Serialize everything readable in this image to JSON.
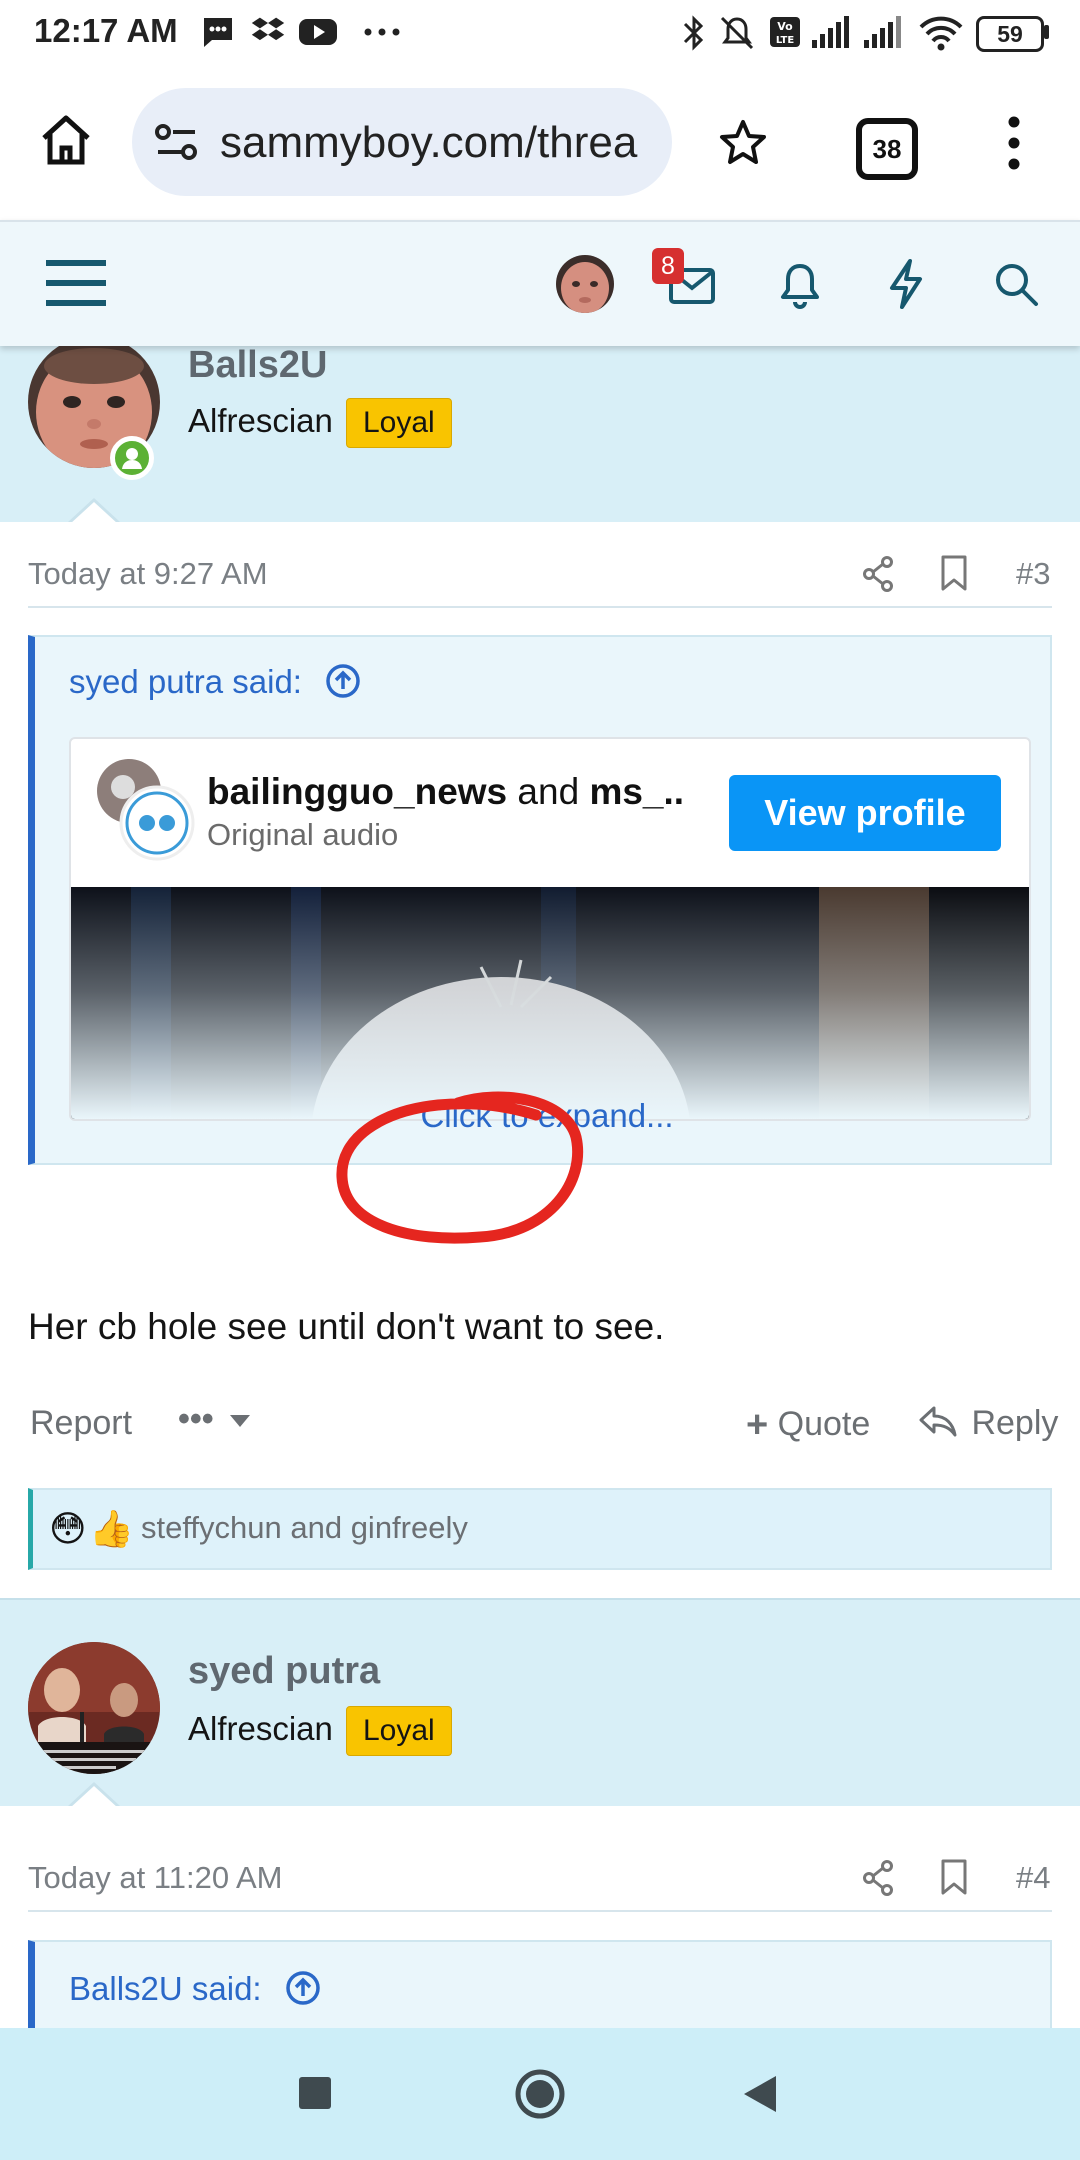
{
  "status_bar": {
    "time": "12:17 AM",
    "battery": "59",
    "left_icons": [
      "messages-icon",
      "dropbox-icon",
      "youtube-icon",
      "more-dots-icon"
    ],
    "right_icons": [
      "bluetooth-icon",
      "mute-icon",
      "volte-icon",
      "signal-icon",
      "signal-icon",
      "wifi-icon",
      "battery-icon"
    ]
  },
  "browser": {
    "url": "sammyboy.com/threa",
    "tabs_count": "38"
  },
  "forum_header": {
    "messages_badge": "8"
  },
  "posts": [
    {
      "username": "Balls2U",
      "user_title": "Alfrescian",
      "badge": "Loyal",
      "date": "Today at 9:27 AM",
      "number": "#3",
      "quote": {
        "header": "syed putra said:",
        "embed": {
          "name_part1": "bailingguo_news",
          "name_join": " and ",
          "name_part2": "ms_..",
          "subtitle": "Original audio",
          "button": "View profile"
        },
        "expand": "Click to expand..."
      },
      "body": "Her cb hole see until don't want to see.",
      "actions": {
        "report": "Report",
        "more": "•••",
        "quote": "Quote",
        "reply": "Reply"
      },
      "reactions": {
        "emojis": [
          "😳",
          "👍"
        ],
        "users": "steffychun and ginfreely"
      }
    },
    {
      "username": "syed putra",
      "user_title": "Alfrescian",
      "badge": "Loyal",
      "date": "Today at 11:20 AM",
      "number": "#4",
      "quote": {
        "header": "Balls2U said:"
      }
    }
  ],
  "colors": {
    "accent": "#0a95f6",
    "link": "#2a68c8",
    "badge": "#f9c400",
    "header_icons": "#16586e",
    "annotation": "#e5261f"
  }
}
